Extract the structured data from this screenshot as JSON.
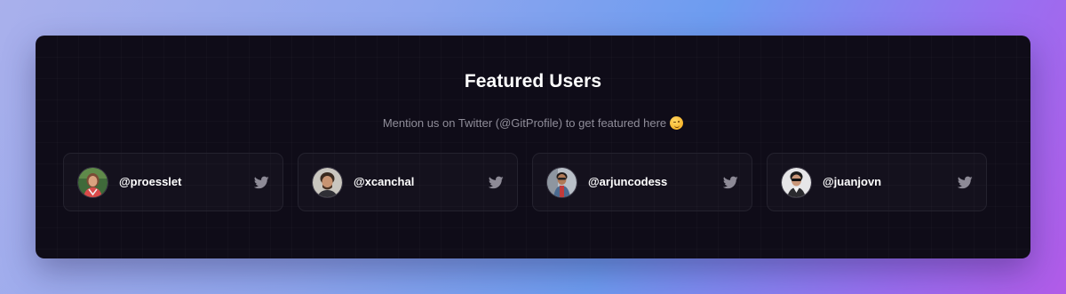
{
  "header": {
    "title": "Featured Users",
    "subtitle": "Mention us on Twitter (@GitProfile) to get featured here"
  },
  "subtitle_emoji": "winking-face-icon",
  "users": [
    {
      "handle": "@proesslet",
      "avatar": "avatar-proesslet",
      "link_icon": "twitter-icon"
    },
    {
      "handle": "@xcanchal",
      "avatar": "avatar-xcanchal",
      "link_icon": "twitter-icon"
    },
    {
      "handle": "@arjuncodess",
      "avatar": "avatar-arjuncodess",
      "link_icon": "twitter-icon"
    },
    {
      "handle": "@juanjovn",
      "avatar": "avatar-juanjovn",
      "link_icon": "twitter-icon"
    }
  ],
  "colors": {
    "panel_bg": "#0f0c18",
    "card_border": "#24222e",
    "text_primary": "#ffffff",
    "text_muted": "#8f8d99",
    "icon_gray": "#8d8a96"
  }
}
